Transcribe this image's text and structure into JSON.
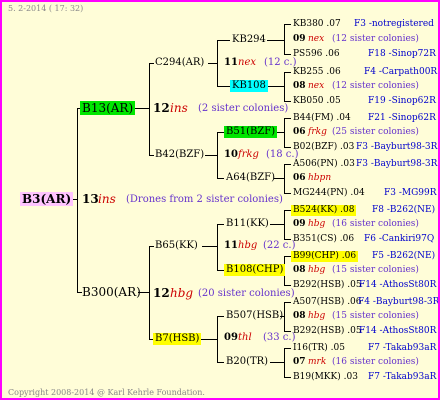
{
  "header": {
    "date": "5. 2-2014 ( 17: 32)"
  },
  "footer": {
    "copyright": "Copyright 2008-2014 @ Karl Kehrle Foundation."
  },
  "colors": {
    "frame": "#ff00ff",
    "background": "#fffdd8",
    "root_highlight": "#ffc4ff",
    "green": "#00e600",
    "yellow": "#ffff00",
    "cyan": "#00ffff",
    "blue_text": "#0000cc",
    "red_text": "#cc0000",
    "purple_text": "#6633cc"
  },
  "root": {
    "label": "B3(AR)",
    "num": "13",
    "code": "ins",
    "note": "(Drones from 2 sister colonies)"
  },
  "gen1": {
    "top": {
      "label": "B13(AR)",
      "num": "12",
      "code": "ins",
      "note": "(2 sister colonies)"
    },
    "bottom": {
      "label": "B300(AR)",
      "num": "12",
      "code": "hbg",
      "note": "(20 sister colonies)"
    }
  },
  "gen2": {
    "c294": {
      "label": "C294(AR)",
      "num": "11",
      "code": "nex",
      "note": "(12 c.)"
    },
    "b42": {
      "label": "B42(BZF)",
      "num": "10",
      "code": "frkg",
      "note": "(18 c.)"
    },
    "b65": {
      "label": "B65(KK)",
      "num": "11",
      "code": "hbg",
      "note": "(22 c.)"
    },
    "b7": {
      "label": "B7(HSB)",
      "num": "09",
      "code": "thl",
      "note": "(33 c.)"
    }
  },
  "gen3": {
    "kb294": "KB294",
    "kb108": "KB108",
    "b51": {
      "label": "B51(BZF)",
      "num": "06",
      "code": "frkg",
      "note": "(25 sister colonies)"
    },
    "a64": "A64(BZF)",
    "b11": {
      "label": "B11(KK)",
      "num": "09",
      "code": "hbg",
      "note": "(16 sister colonies)"
    },
    "b108": {
      "label": "B108(CHP)",
      "num": "08",
      "code": "hbg",
      "note": "(15 sister colonies)"
    },
    "b507": {
      "label": "B507(HSB)",
      "num": "08",
      "code": "hbg",
      "note": "(15 sister colonies)"
    },
    "b20": {
      "label": "B20(TR)",
      "num": "07",
      "code": "mrk",
      "note": "(16 sister colonies)"
    }
  },
  "gen4": {
    "kb380": {
      "label": "KB380 .07",
      "right": "F3 -notregistered"
    },
    "kb294_mid": {
      "num": "09",
      "code": "nex",
      "note": "(12 sister colonies)"
    },
    "ps596": {
      "label": "PS596 .06",
      "right": "F18 -Sinop72R"
    },
    "kb255": {
      "label": "KB255 .06",
      "right": "F4 -Carpath00R"
    },
    "kb108_mid": {
      "num": "08",
      "code": "nex",
      "note": "(12 sister colonies)"
    },
    "kb050": {
      "label": "KB050 .05",
      "right": "F19 -Sinop62R"
    },
    "b44": {
      "label": "B44(FM) .04",
      "right": "F21 -Sinop62R"
    },
    "b02": {
      "label": "B02(BZF) .03",
      "right": "F3 -Bayburt98-3R"
    },
    "a506": {
      "label": "A506(PN) .03",
      "right": "F3 -Bayburt98-3R"
    },
    "a64_mid": {
      "num": "06",
      "code": "hbpn"
    },
    "mg244": {
      "label": "MG244(PN) .04",
      "right": "F3 -MG99R"
    },
    "b524": {
      "label": "B524(KK) .08",
      "right": "F8 -B262(NE)"
    },
    "b351": {
      "label": "B351(CS) .06",
      "right": "F6 -Cankiri97Q"
    },
    "b99": {
      "label": "B99(CHP) .06",
      "right": "F5 -B262(NE)"
    },
    "b292a": {
      "label": "B292(HSB) .05",
      "right": "F14 -AthosSt80R"
    },
    "a507": {
      "label": "A507(HSB) .06",
      "right": "F4 -Bayburt98-3R"
    },
    "b292b": {
      "label": "B292(HSB) .05",
      "right": "F14 -AthosSt80R"
    },
    "i16": {
      "label": "I16(TR) .05",
      "right": "F7 -Takab93aR"
    },
    "b19": {
      "label": "B19(MKK) .03",
      "right": "F7 -Takab93aR"
    }
  }
}
